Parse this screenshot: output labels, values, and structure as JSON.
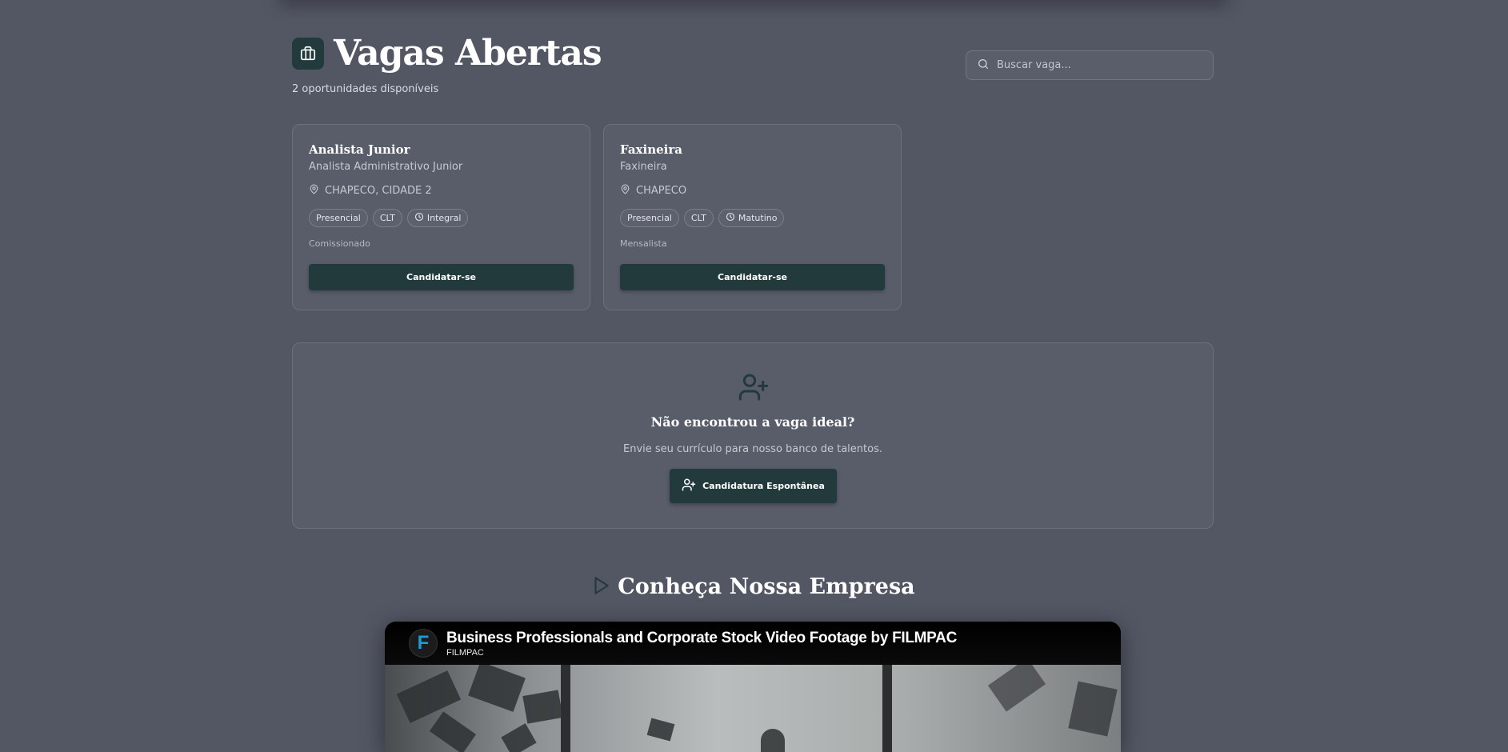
{
  "header": {
    "title": "Vagas Abertas",
    "subtitle": "2 oportunidades disponíveis",
    "title_icon": "briefcase-icon"
  },
  "search": {
    "placeholder": "Buscar vaga...",
    "value": ""
  },
  "jobs": [
    {
      "title": "Analista Junior",
      "role": "Analista Administrativo Junior",
      "location": "CHAPECO, CIDADE 2",
      "tags": {
        "mode": "Presencial",
        "contract": "CLT",
        "shift": "Integral"
      },
      "pay": "Comissionado",
      "button": "Candidatar-se"
    },
    {
      "title": "Faxineira",
      "role": "Faxineira",
      "location": "CHAPECO",
      "tags": {
        "mode": "Presencial",
        "contract": "CLT",
        "shift": "Matutino"
      },
      "pay": "Mensalista",
      "button": "Candidatar-se"
    }
  ],
  "spontaneous": {
    "title": "Não encontrou a vaga ideal?",
    "text": "Envie seu currículo para nosso banco de talentos.",
    "button": "Candidatura Espontânea"
  },
  "company": {
    "section_title": "Conheça Nossa Empresa",
    "video_title": "Business Professionals and Corporate Stock Video Footage by FILMPAC",
    "channel": "FILMPAC",
    "channel_logo_letter": "F"
  },
  "colors": {
    "background": "#535764",
    "card": "#595d6a",
    "accent": "#233a3c",
    "youtube_logo": "#1d9bd7"
  }
}
